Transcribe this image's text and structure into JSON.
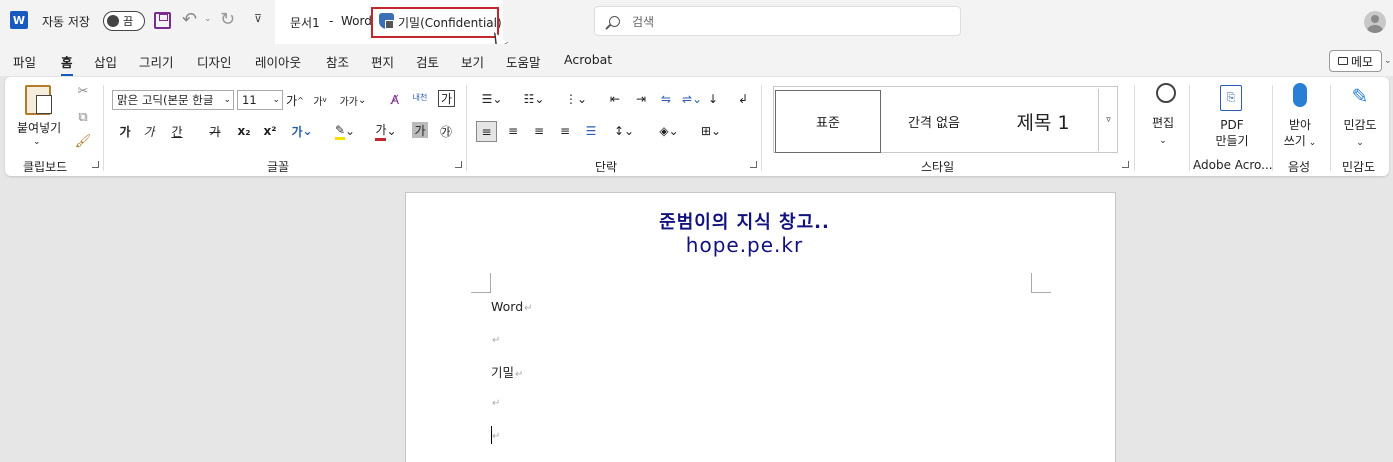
{
  "titlebar": {
    "app_icon": "W",
    "autosave_label": "자동 저장",
    "autosave_state": "끔",
    "doc_name": "문서1",
    "separator": "-",
    "app_name": "Word",
    "sensitivity_label": "기밀(Confidential)",
    "search_placeholder": "검색",
    "highlight_color": "#c1272d"
  },
  "tabs": [
    "파일",
    "홈",
    "삽입",
    "그리기",
    "디자인",
    "레이아웃",
    "참조",
    "편지",
    "검토",
    "보기",
    "도움말",
    "Acrobat"
  ],
  "active_tab": "홈",
  "memo_label": "메모",
  "ribbon": {
    "clipboard": {
      "paste_label": "붙여넣기",
      "group": "클립보드"
    },
    "font": {
      "font_name": "맑은 고딕(본문 한글",
      "font_size": "11",
      "grow": "가",
      "shrink": "가",
      "case": "가가",
      "phonetic": "내천",
      "char_border": "가",
      "bold": "가",
      "italic": "가",
      "underline": "간",
      "strike": "가",
      "sub": "x₂",
      "sup": "x²",
      "effects": "가",
      "font_color": "가",
      "shade": "가",
      "enclose": "㉮",
      "group": "글꼴"
    },
    "paragraph": {
      "group": "단락"
    },
    "styles": {
      "items": [
        "표준",
        "간격 없음",
        "제목 1"
      ],
      "group": "스타일"
    },
    "editing": {
      "label": "편집"
    },
    "adobe": {
      "label_line1": "PDF",
      "label_line2": "만들기",
      "group": "Adobe Acro..."
    },
    "voice": {
      "label_line1": "받아",
      "label_line2": "쓰기",
      "group": "음성"
    },
    "sensitivity": {
      "label": "민감도",
      "group": "민감도"
    }
  },
  "document": {
    "watermark_line1": "준범이의 지식 창고..",
    "watermark_line2": "hope.pe.kr",
    "watermark_color": "#12127e",
    "paragraphs": [
      "Word",
      "",
      "기밀",
      "",
      ""
    ],
    "paragraph_mark": "↵"
  }
}
